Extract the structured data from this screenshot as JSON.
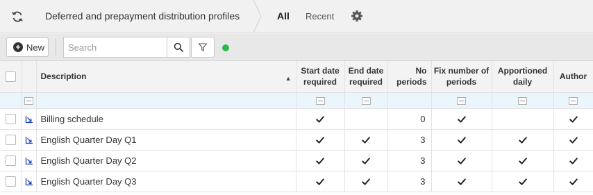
{
  "header": {
    "title": "Deferred and prepayment distribution profiles",
    "tabs": [
      "All",
      "Recent"
    ]
  },
  "toolbar": {
    "new_label": "New",
    "search_placeholder": "Search",
    "search_value": ""
  },
  "colors": {
    "status_dot": "#2db84b",
    "accent_link": "#1a3fb5"
  },
  "icons": {
    "refresh": "refresh-icon",
    "settings": "gear-icon",
    "search": "search-icon",
    "filter": "funnel-icon",
    "row_link": "chart-link-icon",
    "checkmark": "checkmark-icon"
  },
  "grid": {
    "columns": [
      {
        "key": "description",
        "label": "Description"
      },
      {
        "key": "start_date_required",
        "label": "Start date required"
      },
      {
        "key": "end_date_required",
        "label": "End date required"
      },
      {
        "key": "no_periods",
        "label": "No periods"
      },
      {
        "key": "fix_number_of_periods",
        "label": "Fix number of periods"
      },
      {
        "key": "apportioned_daily",
        "label": "Apportioned daily"
      },
      {
        "key": "author",
        "label": "Author"
      }
    ],
    "rows": [
      {
        "description": "Billing schedule",
        "start_date_required": true,
        "end_date_required": false,
        "no_periods": "0",
        "fix_number_of_periods": true,
        "apportioned_daily": false,
        "author": true
      },
      {
        "description": "English Quarter Day Q1",
        "start_date_required": true,
        "end_date_required": true,
        "no_periods": "3",
        "fix_number_of_periods": true,
        "apportioned_daily": true,
        "author": true
      },
      {
        "description": "English Quarter Day Q2",
        "start_date_required": true,
        "end_date_required": true,
        "no_periods": "3",
        "fix_number_of_periods": true,
        "apportioned_daily": true,
        "author": true
      },
      {
        "description": "English Quarter Day Q3",
        "start_date_required": true,
        "end_date_required": true,
        "no_periods": "3",
        "fix_number_of_periods": true,
        "apportioned_daily": true,
        "author": true
      }
    ]
  }
}
